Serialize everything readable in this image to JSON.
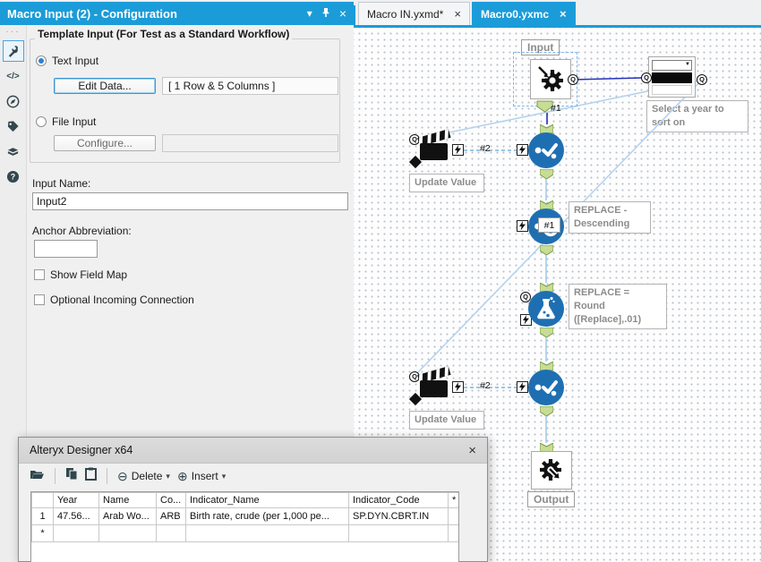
{
  "config_panel": {
    "title": "Macro Input (2) - Configuration",
    "titlebar_menu_glyph": "▾",
    "titlebar_close_glyph": "×",
    "template_group_title": "Template Input (For Test as a Standard Workflow)",
    "text_input_label": "Text Input",
    "edit_data_button": "Edit Data...",
    "data_summary": "[ 1 Row & 5 Columns ]",
    "file_input_label": "File Input",
    "configure_button": "Configure...",
    "input_name_label": "Input Name:",
    "input_name_value": "Input2",
    "anchor_abbreviation_label": "Anchor Abbreviation:",
    "anchor_abbreviation_value": "",
    "show_field_map_label": "Show Field Map",
    "optional_incoming_label": "Optional Incoming Connection"
  },
  "document_tabs": [
    {
      "label": "Macro IN.yxmd*",
      "close_glyph": "×",
      "active": false
    },
    {
      "label": "Macro0.yxmc",
      "close_glyph": "×",
      "active": true
    }
  ],
  "canvas": {
    "input_tool_label": "Input",
    "output_tool_label": "Output",
    "select_year_annotation": "Select a year to sort on",
    "update_value_annotation_1": "Update Value",
    "update_value_annotation_2": "Update Value",
    "replace_descending_annotation": [
      "REPLACE -",
      "Descending"
    ],
    "replace_round_annotation": [
      "REPLACE = Round",
      "([Replace],.01)"
    ],
    "connection_1_label": "#1",
    "connection_2_label": "#2",
    "sort_tool_badge": "#1",
    "anchor_q_glyph": "Q",
    "dropdown_caret_glyph": "▼"
  },
  "dialog": {
    "title": "Alteryx Designer x64",
    "close_glyph": "×",
    "toolbar": {
      "delete_glyph": "⊖",
      "delete_label": "Delete",
      "insert_glyph": "⊕",
      "insert_label": "Insert",
      "caret_glyph": "▾"
    },
    "table": {
      "headers": [
        "",
        "Year",
        "Name",
        "Co...",
        "Indicator_Name",
        "Indicator_Code",
        "*"
      ],
      "row1": {
        "num": "1",
        "year": "47.56...",
        "name": "Arab Wo...",
        "co": "ARB",
        "indicator_name": "Birth rate, crude (per 1,000 pe...",
        "indicator_code": "SP.DYN.CBRT.IN"
      },
      "new_row_marker": "*"
    }
  },
  "colors": {
    "accent_blue": "#1b9cd8",
    "tool_blue": "#1e6fb2",
    "anchor_green": "#c7dd95",
    "navy_connection": "#2433b8",
    "light_connection": "#a6cbe8"
  }
}
